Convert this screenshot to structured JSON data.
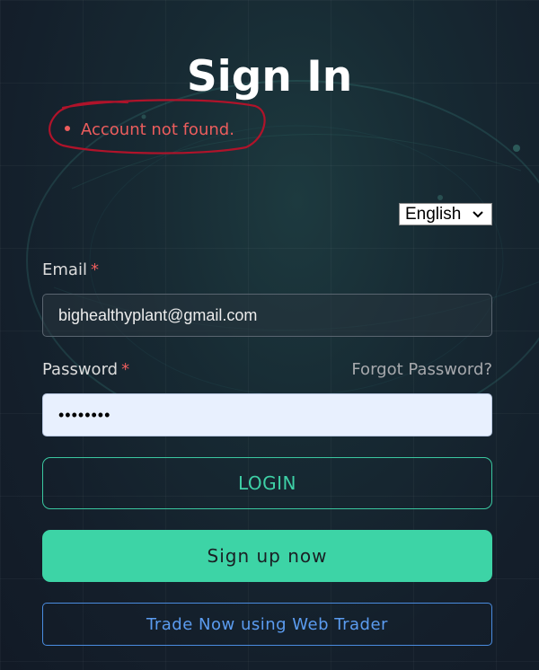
{
  "page": {
    "title": "Sign In"
  },
  "errors": [
    "Account not found."
  ],
  "language": {
    "selected": "English",
    "icon": "chevron-down-icon"
  },
  "email": {
    "label": "Email",
    "required_mark": "*",
    "value": "bighealthyplant@gmail.com"
  },
  "password": {
    "label": "Password",
    "required_mark": "*",
    "value": "••••••••",
    "forgot_link": "Forgot Password?"
  },
  "buttons": {
    "login": "LOGIN",
    "signup": "Sign up now",
    "web_trader": "Trade Now using Web Trader"
  },
  "colors": {
    "accent": "#3dd4a6",
    "error": "#ec5d5d",
    "link_blue": "#5b9cf0",
    "background": "#141f2b"
  }
}
